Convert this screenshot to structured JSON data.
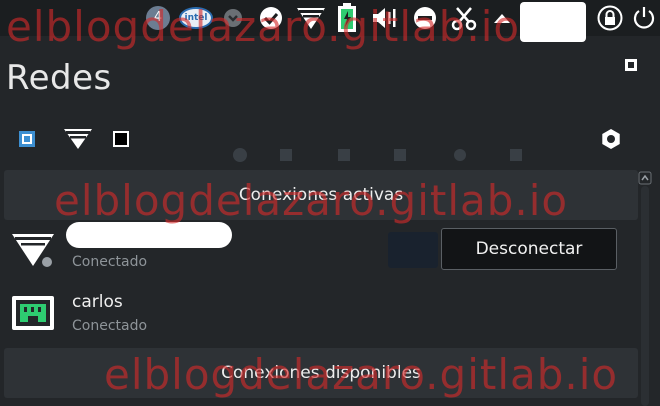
{
  "panel": {
    "notification_count": "4",
    "intel_label": "intel"
  },
  "title": "Redes",
  "sections": {
    "active_title": "Conexiones activas",
    "available_title": "Conexiones disponibles"
  },
  "connections": [
    {
      "name": "",
      "status": "Conectado",
      "icon": "wifi-disconnected-icon"
    },
    {
      "name": "carlos",
      "status": "Conectado",
      "icon": "wired-network-icon"
    }
  ],
  "disconnect_button": "Desconectar",
  "watermark": "elblogdelazaro.gitlab.io",
  "colors": {
    "background": "#232629",
    "panel": "#1b1e20",
    "accent_blue": "#3d8fd1",
    "network_green": "#2ecc71",
    "watermark_red": "#d42a2a"
  }
}
